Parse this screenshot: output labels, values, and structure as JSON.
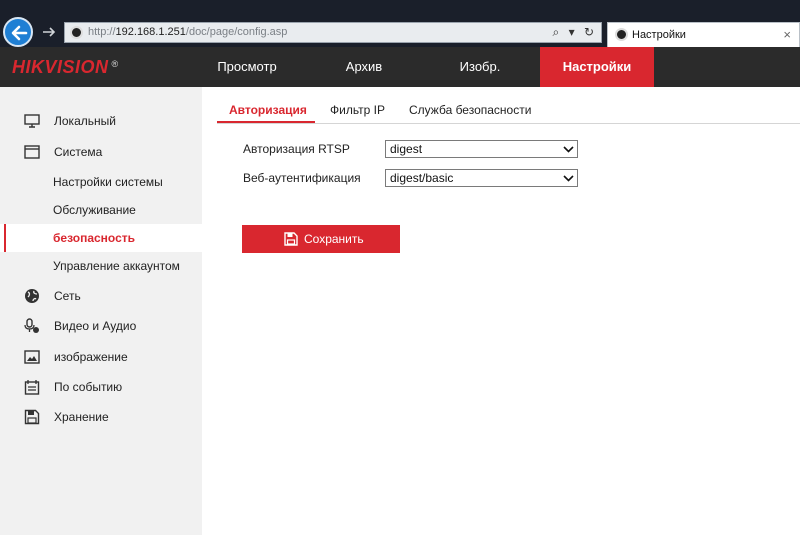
{
  "browser": {
    "url_prefix": "http://",
    "url_host": "192.168.1.251",
    "url_path": "/doc/page/config.asp",
    "address_tools": "⌕ ▾ ↻",
    "tab_title": "Настройки",
    "tab_close": "×"
  },
  "header": {
    "logo": "HIKVISION",
    "logo_mark": "®",
    "nav": [
      "Просмотр",
      "Архив",
      "Изобр.",
      "Настройки"
    ],
    "active_nav": "Настройки"
  },
  "sidebar": {
    "items": [
      {
        "label": "Локальный",
        "icon": "monitor-icon"
      },
      {
        "label": "Система",
        "icon": "system-window-icon"
      },
      {
        "label": "Настройки системы"
      },
      {
        "label": "Обслуживание"
      },
      {
        "label": "безопасность",
        "active": true
      },
      {
        "label": "Управление аккаунтом"
      },
      {
        "label": "Сеть",
        "icon": "globe-icon"
      },
      {
        "label": "Видео и Аудио",
        "icon": "microphone-camera-icon"
      },
      {
        "label": "изображение",
        "icon": "image-icon"
      },
      {
        "label": "По событию",
        "icon": "calendar-icon"
      },
      {
        "label": "Хранение",
        "icon": "storage-disk-icon"
      }
    ]
  },
  "subtabs": [
    "Авторизация",
    "Фильтр IP",
    "Служба безопасности"
  ],
  "form": {
    "rtsp_label": "Авторизация RTSP",
    "rtsp_value": "digest",
    "web_label": "Веб-аутентификация",
    "web_value": "digest/basic",
    "save_label": "Сохранить"
  },
  "colors": {
    "accent": "#d9272f",
    "header_bg": "#2b2b2b",
    "sidebar_bg": "#f1f1f1",
    "browser_chrome": "#1a1f2a"
  }
}
